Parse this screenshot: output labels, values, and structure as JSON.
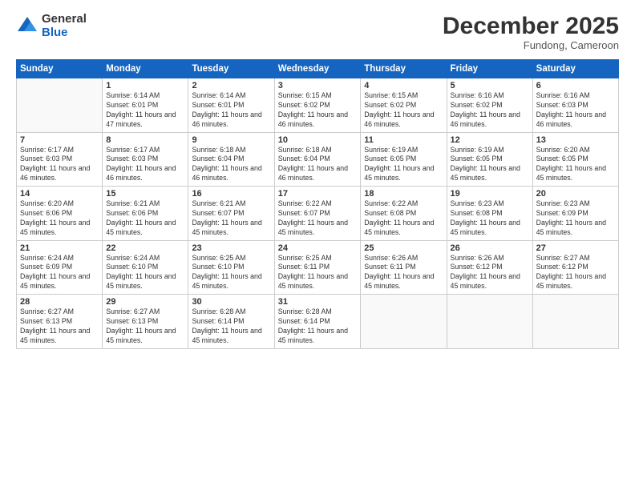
{
  "logo": {
    "general": "General",
    "blue": "Blue"
  },
  "header": {
    "month_year": "December 2025",
    "location": "Fundong, Cameroon"
  },
  "weekdays": [
    "Sunday",
    "Monday",
    "Tuesday",
    "Wednesday",
    "Thursday",
    "Friday",
    "Saturday"
  ],
  "weeks": [
    [
      {
        "day": "",
        "empty": true
      },
      {
        "day": "1",
        "sunrise": "6:14 AM",
        "sunset": "6:01 PM",
        "daylight": "11 hours and 47 minutes."
      },
      {
        "day": "2",
        "sunrise": "6:14 AM",
        "sunset": "6:01 PM",
        "daylight": "11 hours and 46 minutes."
      },
      {
        "day": "3",
        "sunrise": "6:15 AM",
        "sunset": "6:02 PM",
        "daylight": "11 hours and 46 minutes."
      },
      {
        "day": "4",
        "sunrise": "6:15 AM",
        "sunset": "6:02 PM",
        "daylight": "11 hours and 46 minutes."
      },
      {
        "day": "5",
        "sunrise": "6:16 AM",
        "sunset": "6:02 PM",
        "daylight": "11 hours and 46 minutes."
      },
      {
        "day": "6",
        "sunrise": "6:16 AM",
        "sunset": "6:03 PM",
        "daylight": "11 hours and 46 minutes."
      }
    ],
    [
      {
        "day": "7",
        "sunrise": "6:17 AM",
        "sunset": "6:03 PM",
        "daylight": "11 hours and 46 minutes."
      },
      {
        "day": "8",
        "sunrise": "6:17 AM",
        "sunset": "6:03 PM",
        "daylight": "11 hours and 46 minutes."
      },
      {
        "day": "9",
        "sunrise": "6:18 AM",
        "sunset": "6:04 PM",
        "daylight": "11 hours and 46 minutes."
      },
      {
        "day": "10",
        "sunrise": "6:18 AM",
        "sunset": "6:04 PM",
        "daylight": "11 hours and 46 minutes."
      },
      {
        "day": "11",
        "sunrise": "6:19 AM",
        "sunset": "6:05 PM",
        "daylight": "11 hours and 45 minutes."
      },
      {
        "day": "12",
        "sunrise": "6:19 AM",
        "sunset": "6:05 PM",
        "daylight": "11 hours and 45 minutes."
      },
      {
        "day": "13",
        "sunrise": "6:20 AM",
        "sunset": "6:05 PM",
        "daylight": "11 hours and 45 minutes."
      }
    ],
    [
      {
        "day": "14",
        "sunrise": "6:20 AM",
        "sunset": "6:06 PM",
        "daylight": "11 hours and 45 minutes."
      },
      {
        "day": "15",
        "sunrise": "6:21 AM",
        "sunset": "6:06 PM",
        "daylight": "11 hours and 45 minutes."
      },
      {
        "day": "16",
        "sunrise": "6:21 AM",
        "sunset": "6:07 PM",
        "daylight": "11 hours and 45 minutes."
      },
      {
        "day": "17",
        "sunrise": "6:22 AM",
        "sunset": "6:07 PM",
        "daylight": "11 hours and 45 minutes."
      },
      {
        "day": "18",
        "sunrise": "6:22 AM",
        "sunset": "6:08 PM",
        "daylight": "11 hours and 45 minutes."
      },
      {
        "day": "19",
        "sunrise": "6:23 AM",
        "sunset": "6:08 PM",
        "daylight": "11 hours and 45 minutes."
      },
      {
        "day": "20",
        "sunrise": "6:23 AM",
        "sunset": "6:09 PM",
        "daylight": "11 hours and 45 minutes."
      }
    ],
    [
      {
        "day": "21",
        "sunrise": "6:24 AM",
        "sunset": "6:09 PM",
        "daylight": "11 hours and 45 minutes."
      },
      {
        "day": "22",
        "sunrise": "6:24 AM",
        "sunset": "6:10 PM",
        "daylight": "11 hours and 45 minutes."
      },
      {
        "day": "23",
        "sunrise": "6:25 AM",
        "sunset": "6:10 PM",
        "daylight": "11 hours and 45 minutes."
      },
      {
        "day": "24",
        "sunrise": "6:25 AM",
        "sunset": "6:11 PM",
        "daylight": "11 hours and 45 minutes."
      },
      {
        "day": "25",
        "sunrise": "6:26 AM",
        "sunset": "6:11 PM",
        "daylight": "11 hours and 45 minutes."
      },
      {
        "day": "26",
        "sunrise": "6:26 AM",
        "sunset": "6:12 PM",
        "daylight": "11 hours and 45 minutes."
      },
      {
        "day": "27",
        "sunrise": "6:27 AM",
        "sunset": "6:12 PM",
        "daylight": "11 hours and 45 minutes."
      }
    ],
    [
      {
        "day": "28",
        "sunrise": "6:27 AM",
        "sunset": "6:13 PM",
        "daylight": "11 hours and 45 minutes."
      },
      {
        "day": "29",
        "sunrise": "6:27 AM",
        "sunset": "6:13 PM",
        "daylight": "11 hours and 45 minutes."
      },
      {
        "day": "30",
        "sunrise": "6:28 AM",
        "sunset": "6:14 PM",
        "daylight": "11 hours and 45 minutes."
      },
      {
        "day": "31",
        "sunrise": "6:28 AM",
        "sunset": "6:14 PM",
        "daylight": "11 hours and 45 minutes."
      },
      {
        "day": "",
        "empty": true
      },
      {
        "day": "",
        "empty": true
      },
      {
        "day": "",
        "empty": true
      }
    ]
  ]
}
